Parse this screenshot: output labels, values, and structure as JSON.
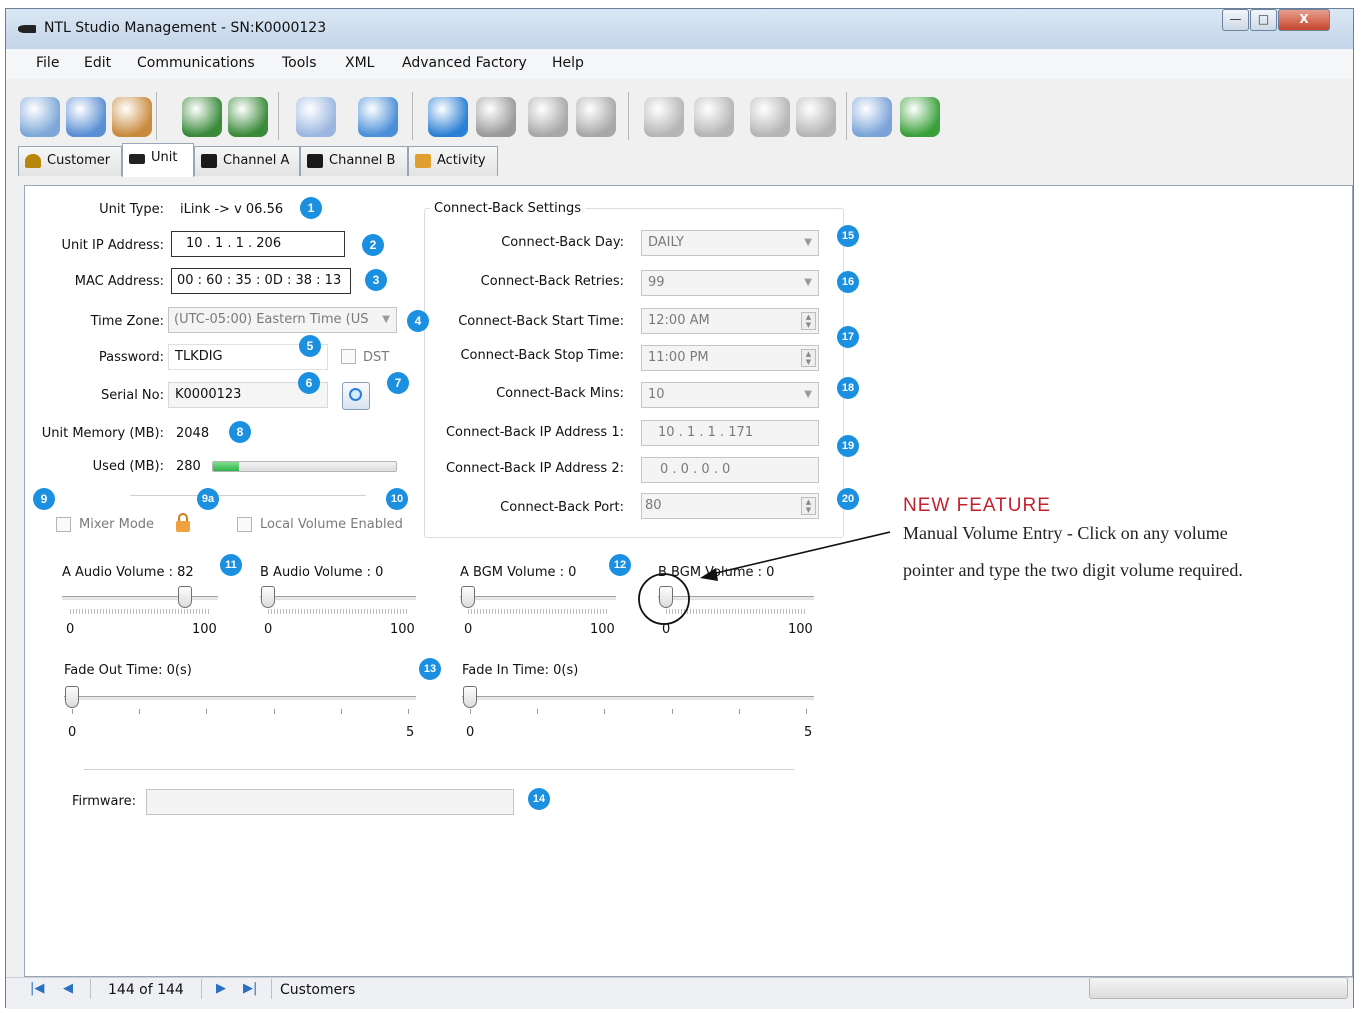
{
  "window": {
    "title": "NTL Studio Management -  SN:K0000123",
    "controls": {
      "minimize": "—",
      "maximize": "□",
      "close": "X"
    }
  },
  "menu": [
    "File",
    "Edit",
    "Communications",
    "Tools",
    "XML",
    "Advanced Factory",
    "Help"
  ],
  "toolbar_icons": [
    "customers-icon",
    "edit-customer-icon",
    "users-icon",
    "download-icon",
    "upload-icon",
    "contact-card-icon",
    "recycle-bin-icon",
    "globe-refresh-icon",
    "disconnect-icon",
    "globe-search-icon",
    "globe-icon",
    "save-icon",
    "settings-icon",
    "home-icon",
    "home-settings-icon",
    "documents-icon",
    "link-icon"
  ],
  "tabs": [
    "Customer",
    "Unit",
    "Channel A",
    "Channel B",
    "Activity"
  ],
  "unit": {
    "unit_type_label": "Unit Type:",
    "unit_type_value": "iLink -> v 06.56",
    "ip_label": "Unit IP Address:",
    "ip_value": "10  .  1  .  1  . 206",
    "mac_label": "MAC Address:",
    "mac_value": "00 : 60 : 35 : 0D : 38 : 13",
    "tz_label": "Time Zone:",
    "tz_value": "(UTC-05:00) Eastern Time (US",
    "password_label": "Password:",
    "password_value": "TLKDIG",
    "dst_label": "DST",
    "serial_label": "Serial No:",
    "serial_value": "K0000123",
    "memory_label": "Unit Memory (MB):",
    "memory_value": "2048",
    "used_label": "Used (MB):",
    "used_value": "280",
    "used_fraction": 0.14,
    "mixer_label": "Mixer Mode",
    "local_volume_label": "Local Volume Enabled"
  },
  "connect_back": {
    "group_title": "Connect-Back Settings",
    "day_label": "Connect-Back Day:",
    "day_value": "DAILY",
    "retries_label": "Connect-Back Retries:",
    "retries_value": "99",
    "start_label": "Connect-Back Start Time:",
    "start_value": "12:00 AM",
    "stop_label": "Connect-Back Stop Time:",
    "stop_value": "11:00 PM",
    "mins_label": "Connect-Back Mins:",
    "mins_value": "10",
    "ip1_label": "Connect-Back IP Address 1:",
    "ip1_value": "10  .   1   .   1  . 171",
    "ip2_label": "Connect-Back IP Address 2:",
    "ip2_value": "0   .   0   .   0   .   0",
    "port_label": "Connect-Back Port:",
    "port_value": "80"
  },
  "volumes": [
    {
      "label": "A Audio Volume : 82",
      "value": 82,
      "min": "0",
      "max": "100"
    },
    {
      "label": "B Audio Volume : 0",
      "value": 0,
      "min": "0",
      "max": "100"
    },
    {
      "label": "A BGM Volume : 0",
      "value": 0,
      "min": "0",
      "max": "100"
    },
    {
      "label": "B BGM Volume : 0",
      "value": 0,
      "min": "0",
      "max": "100"
    }
  ],
  "fades": [
    {
      "label": "Fade Out Time: 0(s)",
      "value": 0,
      "min": "0",
      "max": "5"
    },
    {
      "label": "Fade In Time: 0(s)",
      "value": 0,
      "min": "0",
      "max": "5"
    }
  ],
  "firmware": {
    "label": "Firmware:",
    "value": ""
  },
  "badges": [
    "1",
    "2",
    "3",
    "4",
    "5",
    "6",
    "7",
    "8",
    "9",
    "9a",
    "10",
    "11",
    "12",
    "13",
    "14",
    "15",
    "16",
    "17",
    "18",
    "19",
    "20"
  ],
  "annotation": {
    "title": "NEW FEATURE",
    "line1": "Manual Volume Entry - Click on any volume",
    "line2": "pointer and type the two digit volume required."
  },
  "statusbar": {
    "record_position": "144 of 144",
    "section": "Customers"
  },
  "colors": {
    "badge": "#1b8fe0",
    "accent_red": "#c5202e",
    "progress": "#2fb34a"
  }
}
